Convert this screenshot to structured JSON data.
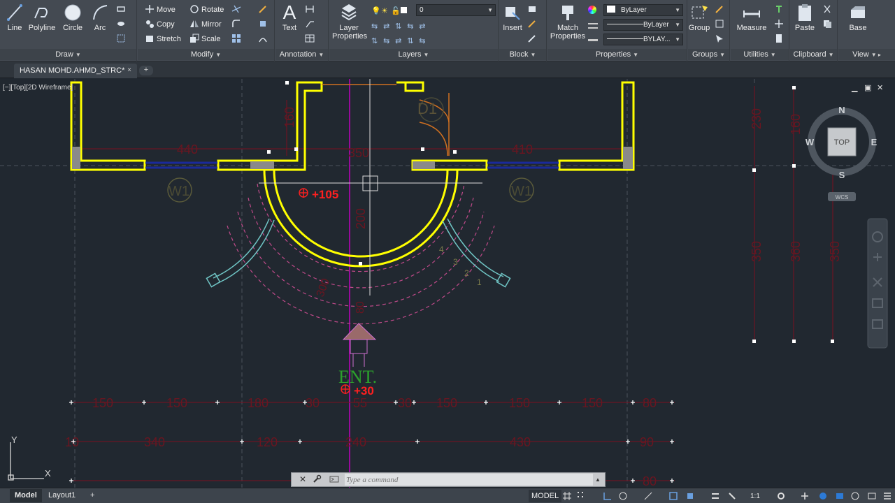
{
  "ribbon": {
    "draw": {
      "title": "Draw",
      "line": "Line",
      "polyline": "Polyline",
      "circle": "Circle",
      "arc": "Arc"
    },
    "modify": {
      "title": "Modify",
      "move": "Move",
      "rotate": "Rotate",
      "copy": "Copy",
      "mirror": "Mirror",
      "stretch": "Stretch",
      "scale": "Scale"
    },
    "annotation": {
      "title": "Annotation",
      "text": "Text",
      "text_glyph": "A"
    },
    "layers": {
      "title": "Layers",
      "layer_properties_1": "Layer",
      "layer_properties_2": "Properties",
      "current_layer": "0"
    },
    "block": {
      "title": "Block",
      "insert": "Insert"
    },
    "properties": {
      "title": "Properties",
      "match_1": "Match",
      "match_2": "Properties",
      "color": "ByLayer",
      "linetype": "ByLayer",
      "lineweight": "BYLAY..."
    },
    "groups": {
      "title": "Groups",
      "group": "Group"
    },
    "utilities": {
      "title": "Utilities",
      "measure": "Measure"
    },
    "clipboard": {
      "title": "Clipboard",
      "paste": "Paste"
    },
    "view": {
      "title": "View",
      "base": "Base"
    }
  },
  "tabs": {
    "document": "HASAN MOHD.AHMD_STRC*",
    "close": "×",
    "new": "+"
  },
  "viewport": {
    "label": "[−][Top][2D Wireframe]",
    "min": "▁",
    "restore": "▣",
    "close": "✕"
  },
  "viewcube": {
    "face": "TOP",
    "north": "N",
    "south": "S",
    "east": "E",
    "west": "W",
    "ucs": "WCS"
  },
  "drawing": {
    "door_tag": "D1",
    "window_tags": [
      "W1",
      "W1"
    ],
    "level_upper": "+105",
    "level_entry": "+30",
    "entrance": "ENT.",
    "step_numbers": [
      "4",
      "3",
      "2",
      "1"
    ],
    "top_dims": [
      "440",
      "350",
      "410"
    ],
    "wall_dim_160": "160",
    "dim_200": "200",
    "dim_300": "300",
    "dim_80": "80",
    "right_vertical_upper": [
      "230",
      "160"
    ],
    "right_vertical_lower": [
      "350",
      "360",
      "350"
    ],
    "row1": [
      "150",
      "150",
      "180",
      "30",
      "55",
      "30",
      "150",
      "150",
      "150",
      "80"
    ],
    "row2": [
      "10",
      "340",
      "120",
      "240",
      "430",
      "90"
    ],
    "row3": [
      "80"
    ],
    "ucs_x": "X",
    "ucs_y": "Y"
  },
  "command": {
    "placeholder": "Type a command",
    "close": "✕",
    "settings": "🔧"
  },
  "status": {
    "model_tab": "Model",
    "layout_tab": "Layout1",
    "add_tab": "+",
    "model_space": "MODEL",
    "annotation_scale": "1:1"
  },
  "colors": {
    "canvas": "#212830",
    "wall": "#ffff00",
    "dimension": "#b01020",
    "pink": "#c04a8a",
    "cyan": "#6fc4c4",
    "magenta": "#c000c0",
    "green": "#2ca02c",
    "red": "#ff2020"
  }
}
